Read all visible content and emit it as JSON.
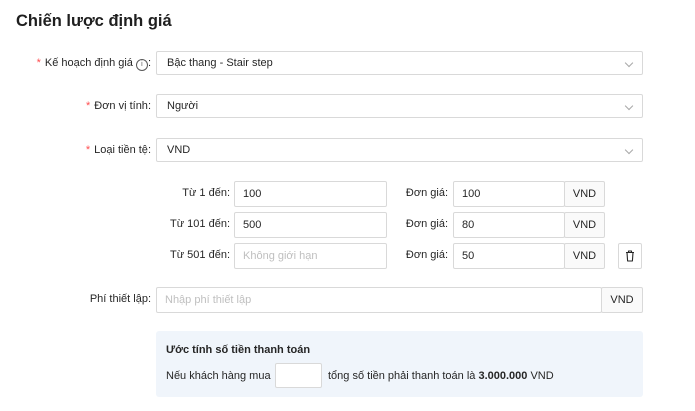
{
  "page": {
    "title": "Chiến lược định giá"
  },
  "form": {
    "plan": {
      "label": "Kế hoạch định giá",
      "info_icon": "info-circle-icon",
      "value": "Bậc thang - Stair step"
    },
    "unit": {
      "label": "Đơn vị tính",
      "value": "Người"
    },
    "currency": {
      "label": "Loại tiền tệ",
      "value": "VND"
    },
    "colon": ":",
    "required_mark": "*"
  },
  "tiers": [
    {
      "from_label": "Từ 1 đến",
      "to_value": "100",
      "to_placeholder": "",
      "price_label": "Đơn giá",
      "price": "100",
      "currency": "VND"
    },
    {
      "from_label": "Từ 101 đến",
      "to_value": "500",
      "to_placeholder": "",
      "price_label": "Đơn giá",
      "price": "80",
      "currency": "VND"
    },
    {
      "from_label": "Từ 501 đến",
      "to_value": "",
      "to_placeholder": "Không giới hạn",
      "price_label": "Đơn giá",
      "price": "50",
      "currency": "VND"
    }
  ],
  "setup_fee": {
    "label": "Phí thiết lập",
    "placeholder": "Nhập phí thiết lập",
    "currency": "VND"
  },
  "estimate": {
    "title": "Ước tính số tiền thanh toán",
    "prefix": "Nếu khách hàng mua",
    "quantity_value": "",
    "suffix": "tổng số tiền phải thanh toán là",
    "total": "3.000.000",
    "currency": "VND"
  }
}
